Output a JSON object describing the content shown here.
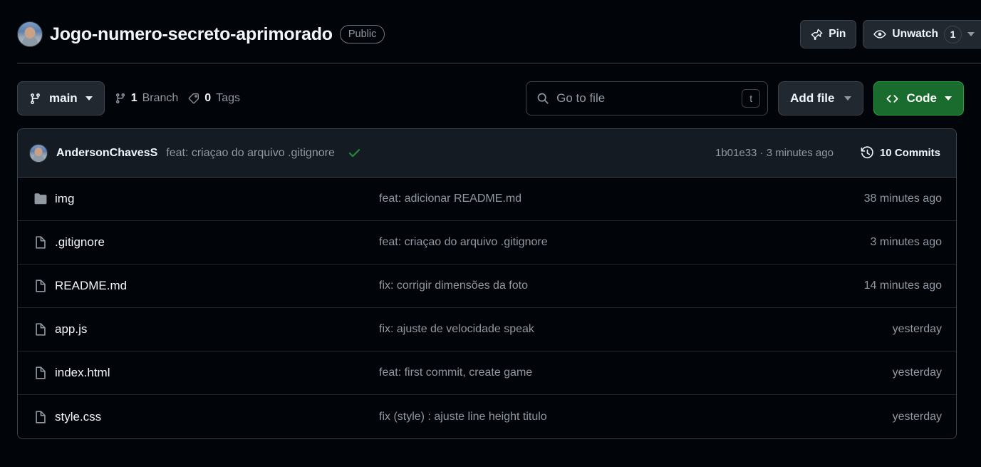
{
  "header": {
    "avatar_alt": "user-avatar",
    "repo_name": "Jogo-numero-secreto-aprimorado",
    "visibility": "Public",
    "pin_label": "Pin",
    "watch_label": "Unwatch",
    "watch_count": "1"
  },
  "toolbar": {
    "branch_name": "main",
    "branch_count": "1",
    "branch_count_label": "Branch",
    "tag_count": "0",
    "tag_count_label": "Tags",
    "search_placeholder": "Go to file",
    "search_value": "",
    "search_shortcut": "t",
    "add_file_label": "Add file",
    "code_label": "Code"
  },
  "commit_bar": {
    "author": "AndersonChavesS",
    "message": "feat: criaçao do arquivo .gitignore",
    "status": "check-success",
    "hash": "1b01e33",
    "separator": " · ",
    "relative_time": "3 minutes ago",
    "commits_count_label": "10 Commits"
  },
  "files": [
    {
      "name": "img",
      "type": "folder",
      "commit_message": "feat: adicionar README.md",
      "time": "38 minutes ago"
    },
    {
      "name": ".gitignore",
      "type": "file",
      "commit_message": "feat: criaçao do arquivo .gitignore",
      "time": "3 minutes ago"
    },
    {
      "name": "README.md",
      "type": "file",
      "commit_message": "fix: corrigir dimensões da foto",
      "time": "14 minutes ago"
    },
    {
      "name": "app.js",
      "type": "file",
      "commit_message": "fix: ajuste de velocidade speak",
      "time": "yesterday"
    },
    {
      "name": "index.html",
      "type": "file",
      "commit_message": "feat: first commit, create game",
      "time": "yesterday"
    },
    {
      "name": "style.css",
      "type": "file",
      "commit_message": "fix (style) : ajuste line height titulo",
      "time": "yesterday"
    }
  ],
  "colors": {
    "page_background": "#010409",
    "panel_background": "#151b23",
    "border": "#3d444d",
    "row_border": "#21262d",
    "text_primary": "#f0f6fc",
    "text_muted": "#9198a1",
    "accent_green": "#196c2e",
    "check_green": "#238636",
    "link_blue": "#4493f8"
  }
}
